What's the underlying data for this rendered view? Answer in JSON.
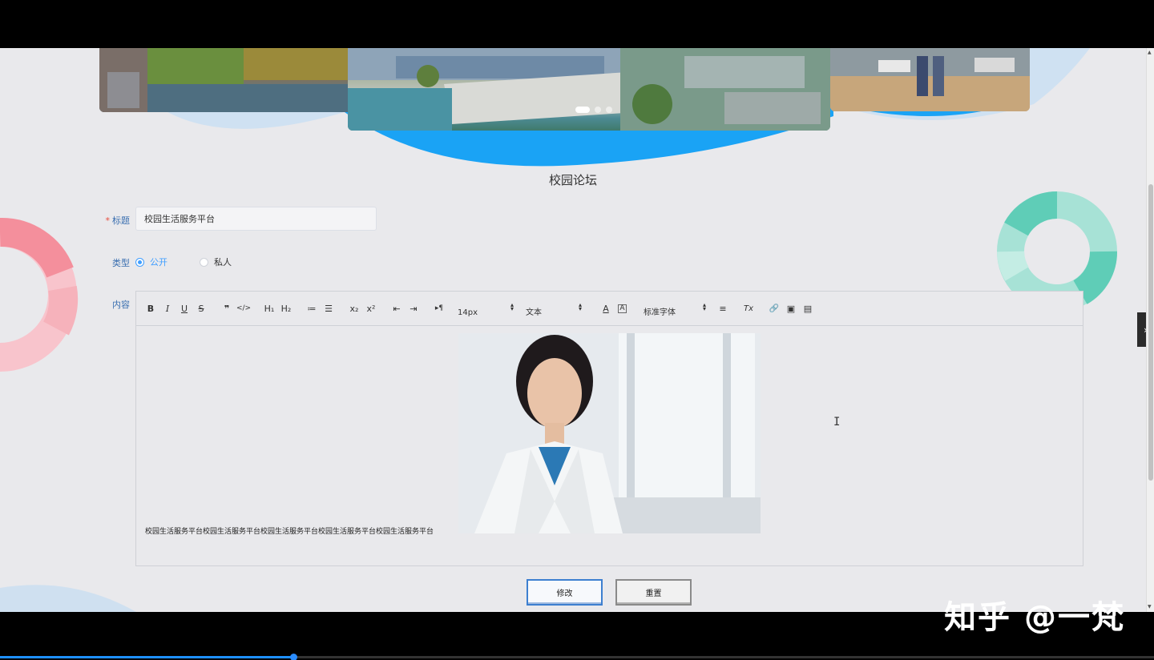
{
  "page": {
    "title": "校园论坛"
  },
  "carousel": {
    "slide_count": 3,
    "active_index": 0
  },
  "form": {
    "title_label": "标题",
    "required_mark": "*",
    "title_value": "校园生活服务平台",
    "type_label": "类型",
    "type_options": [
      {
        "label": "公开",
        "checked": true
      },
      {
        "label": "私人",
        "checked": false
      }
    ],
    "content_label": "内容"
  },
  "toolbar": {
    "bold": "B",
    "italic": "I",
    "underline": "U",
    "strike": "S",
    "quote": "❞",
    "code": "</>",
    "h1": "H₁",
    "h2": "H₂",
    "ordered_list": "≔",
    "bullet_list": "☰",
    "subscript": "x₂",
    "superscript": "x²",
    "outdent": "⇤",
    "indent": "⇥",
    "direction": "▸¶",
    "font_size": "14px",
    "heading": "文本",
    "font_color": "A",
    "bg_color": "A",
    "font_family": "标准字体",
    "align": "≡",
    "clean": "Tx",
    "link": "🔗",
    "image": "▣",
    "video": "▤"
  },
  "editor": {
    "text": "校园生活服务平台校园生活服务平台校园生活服务平台校园生活服务平台校园生活服务平台"
  },
  "buttons": {
    "submit": "修改",
    "reset": "重置"
  },
  "video_player": {
    "progress_percent": 25.4,
    "watermark": "知乎 @一梵"
  },
  "colors": {
    "accent": "#409eff",
    "wave": "#1aa3f5",
    "donut_left": "#f7a2ad",
    "donut_right": "#5fcdb7"
  }
}
